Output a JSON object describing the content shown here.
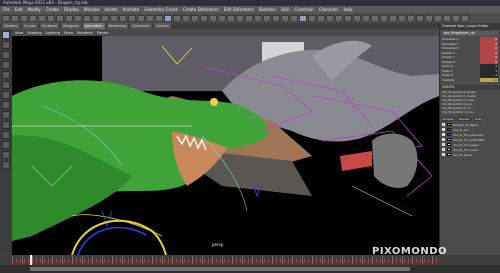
{
  "window": {
    "title": "Autodesk Maya 2011 x64 - Dragon_rig.mb"
  },
  "menus": [
    "File",
    "Edit",
    "Modify",
    "Create",
    "Display",
    "Window",
    "Assets",
    "Animate",
    "Geometry Cache",
    "Create Deformers",
    "Edit Deformers",
    "Skeleton",
    "Skin",
    "Constrain",
    "Character",
    "Help"
  ],
  "tabs": [
    {
      "label": "General",
      "active": false
    },
    {
      "label": "Curves",
      "active": false
    },
    {
      "label": "Surfaces",
      "active": false
    },
    {
      "label": "Polygons",
      "active": false
    },
    {
      "label": "Animation",
      "active": true
    },
    {
      "label": "Rendering",
      "active": false
    },
    {
      "label": "Dynamics",
      "active": false
    },
    {
      "label": "Custom",
      "active": false
    }
  ],
  "viewport_menu": [
    "View",
    "Shading",
    "Lighting",
    "Show",
    "Renderer",
    "Panels"
  ],
  "viewport": {
    "camera_label": "persp"
  },
  "channel_box": {
    "header": "Channel Box / Layer Editor",
    "node": "dra_Ringdistort_ctrl",
    "attributes": [
      {
        "name": "Translate X",
        "value": "0",
        "color": "red"
      },
      {
        "name": "Translate Y",
        "value": "0",
        "color": "red"
      },
      {
        "name": "Translate Z",
        "value": "0",
        "color": "red"
      },
      {
        "name": "Rotate X",
        "value": "0",
        "color": "red"
      },
      {
        "name": "Rotate Y",
        "value": "0",
        "color": "red"
      },
      {
        "name": "Rotate Z",
        "value": "0",
        "color": "red"
      },
      {
        "name": "Scale X",
        "value": "1",
        "color": "none"
      },
      {
        "name": "Scale Y",
        "value": "1",
        "color": "none"
      },
      {
        "name": "Scale Z",
        "value": "1",
        "color": "none"
      },
      {
        "name": "Visibility",
        "value": "on",
        "color": "yellow"
      }
    ],
    "shapes_header": "SHAPES",
    "inputs": [
      "dra_Ringdistort_shape",
      "dra_Ringdistort_cluster",
      "dra_Ringdistort_scale",
      "dra_Ringdistort_pos",
      "dra_Ringdistort_rot",
      "dra_Ringdistort_local"
    ]
  },
  "layers": {
    "tabs": [
      "Display",
      "Render",
      "Anim"
    ],
    "items": [
      {
        "name": "Dragon_fk_Mesh",
        "color": "#e6c23a"
      },
      {
        "name": "dra_fk_ctrl",
        "color": "#d33a3a"
      },
      {
        "name": "dra_fk_ctrl_secondry",
        "color": "#3a49d8"
      },
      {
        "name": "dra_fk_ctrl_extended",
        "color": "#7dd3e0"
      },
      {
        "name": "dra_fk_ctrl_upper",
        "color": "#e6e6e6"
      },
      {
        "name": "dra_fk_ctrl_lower",
        "color": "#e6e6e6"
      },
      {
        "name": "dra_fk_spine",
        "color": "#e6e6e6"
      }
    ]
  },
  "watermark": "PIXOMONDO",
  "colors": {
    "dragon_skin": "#3fa33a",
    "dragon_mouth": "#c9875a",
    "wing_curve": "#c13bd1",
    "background_dragon": "#8a8a93"
  }
}
